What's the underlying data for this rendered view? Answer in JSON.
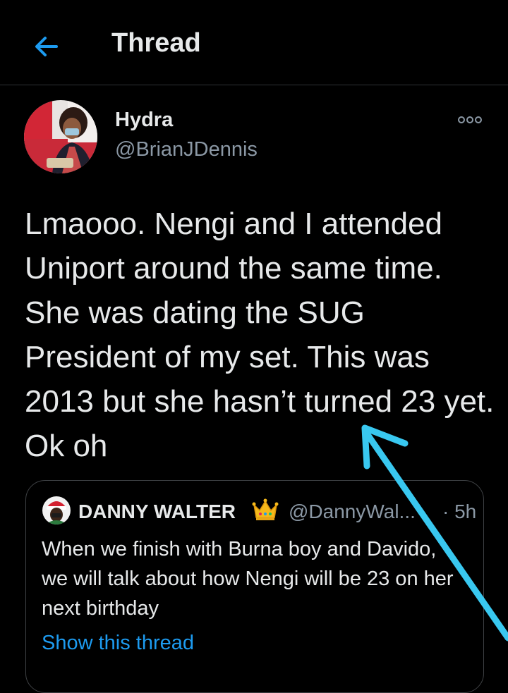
{
  "header": {
    "title": "Thread",
    "back_icon": "arrow-left-icon",
    "accent_color": "#1d9bf0"
  },
  "tweet": {
    "display_name": "Hydra",
    "handle": "@BrianJDennis",
    "text": "Lmaooo. Nengi and I attended Uniport around the same time. She was dating the SUG President of my set. This was 2013 but she hasn’t turned 23 yet. Ok oh",
    "more_icon": "more-options-icon"
  },
  "quoted_tweet": {
    "display_name": "DANNY WALTER",
    "badge_icon": "crown-emoji-icon",
    "handle": "@DannyWal...",
    "time": "· 5h",
    "text": "When we finish with Burna boy and Davido, we will talk about how Nengi will be 23 on her next birthday",
    "show_thread_label": "Show this thread"
  },
  "annotation": {
    "icon": "annotation-arrow-icon",
    "color": "#39c8f0"
  }
}
